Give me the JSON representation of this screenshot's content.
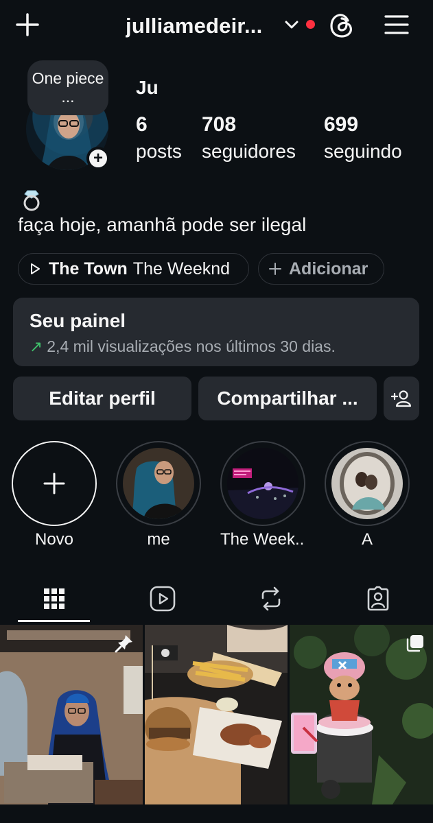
{
  "header": {
    "username": "julliamedeir...",
    "icons": [
      "plus-icon",
      "chevron-down-icon",
      "threads-icon",
      "menu-icon"
    ]
  },
  "profile": {
    "note": "One piece ...",
    "display_name": "Ju",
    "stats": [
      {
        "value": "6",
        "label": "posts"
      },
      {
        "value": "708",
        "label": "seguidores"
      },
      {
        "value": "699",
        "label": "seguindo"
      }
    ],
    "bio_emoji": "ring-icon",
    "bio": "faça hoje, amanhã pode ser ilegal"
  },
  "music": {
    "song": "The Town",
    "artist": "The Weeknd",
    "add_label": "Adicionar"
  },
  "dashboard": {
    "title": "Seu painel",
    "subtitle": "2,4 mil visualizações nos últimos 30 dias."
  },
  "actions": {
    "edit": "Editar perfil",
    "share": "Compartilhar ...",
    "discover": "add-person-icon"
  },
  "highlights": [
    {
      "label": "Novo"
    },
    {
      "label": "me"
    },
    {
      "label": "The Week..."
    },
    {
      "label": "A"
    }
  ],
  "tabs": [
    "grid-icon",
    "reels-icon",
    "reposts-icon",
    "tagged-icon"
  ],
  "colors": {
    "background": "#0c1014",
    "card": "#262a30",
    "notification": "#ff3040",
    "trend": "#3fbf6a"
  }
}
